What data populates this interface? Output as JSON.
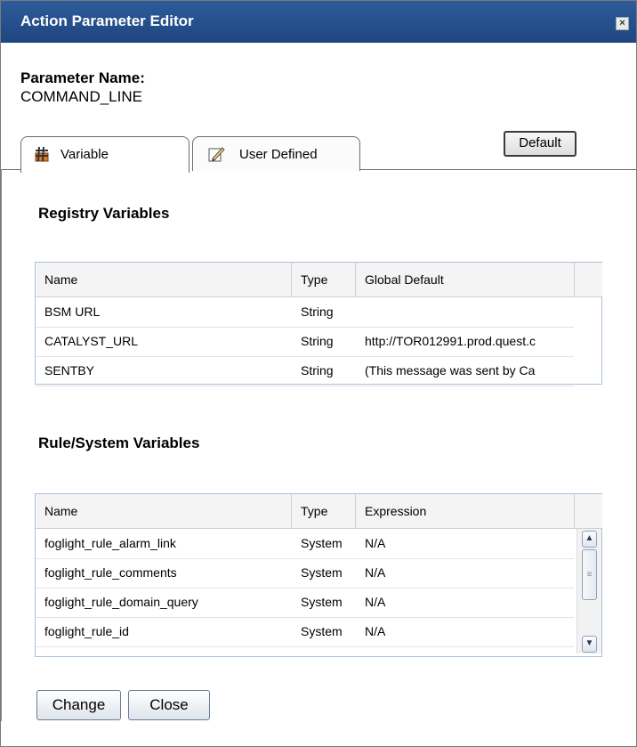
{
  "window": {
    "title": "Action Parameter Editor",
    "close_glyph": "×"
  },
  "parameter": {
    "label": "Parameter Name:",
    "value": "COMMAND_LINE"
  },
  "tabs": [
    {
      "label": "Variable",
      "icon": "hash-icon",
      "active": true
    },
    {
      "label": "User Defined",
      "icon": "pencil-icon",
      "active": false
    }
  ],
  "default_button": "Default",
  "registry": {
    "title": "Registry Variables",
    "columns": [
      "Name",
      "Type",
      "Global Default"
    ],
    "rows": [
      [
        "BSM URL",
        "String",
        ""
      ],
      [
        "CATALYST_URL",
        "String",
        "http://TOR012991.prod.quest.c"
      ],
      [
        "SENTBY",
        "String",
        "(This message was sent by Ca"
      ]
    ]
  },
  "rule": {
    "title": "Rule/System Variables",
    "columns": [
      "Name",
      "Type",
      "Expression"
    ],
    "rows": [
      [
        "foglight_rule_alarm_link",
        "System",
        "N/A"
      ],
      [
        "foglight_rule_comments",
        "System",
        "N/A"
      ],
      [
        "foglight_rule_domain_query",
        "System",
        "N/A"
      ],
      [
        "foglight_rule_id",
        "System",
        "N/A"
      ]
    ],
    "scroll": {
      "up": "▲",
      "down": "▼",
      "thumb": "≡"
    }
  },
  "buttons": {
    "change": "Change",
    "close": "Close"
  },
  "colors": {
    "titlebar": "#1f467f",
    "grid_border": "#a9c1dc"
  }
}
